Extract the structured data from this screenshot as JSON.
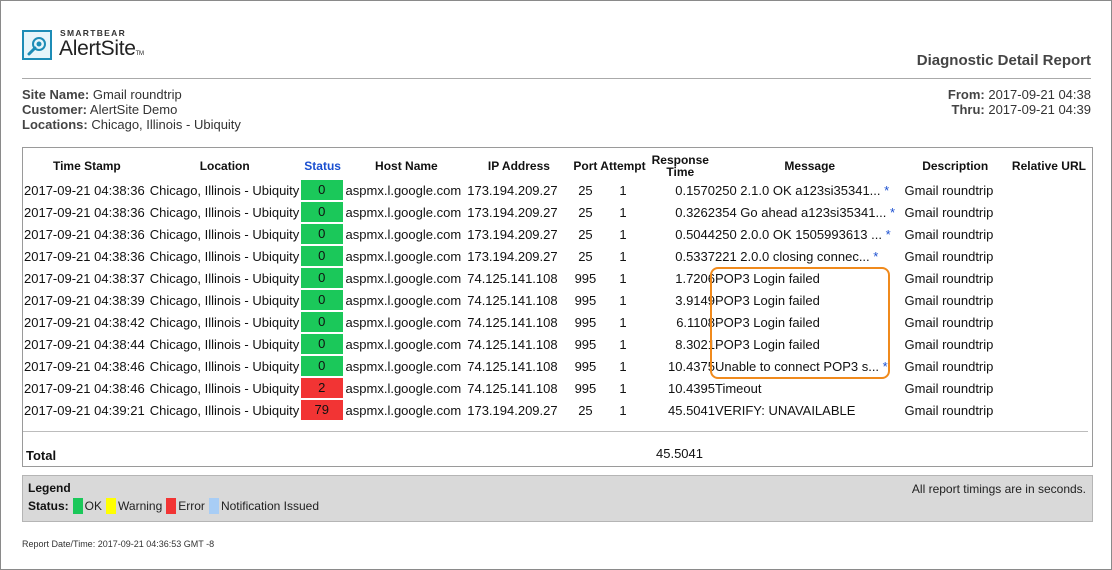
{
  "header": {
    "brand": "SMARTBEAR",
    "product": "AlertSite",
    "trademark": "TM",
    "report_title": "Diagnostic Detail Report"
  },
  "meta": {
    "site_name_label": "Site Name:",
    "site_name": "Gmail roundtrip",
    "customer_label": "Customer:",
    "customer": "AlertSite Demo",
    "locations_label": "Locations:",
    "locations": "Chicago, Illinois - Ubiquity",
    "from_label": "From:",
    "from": "2017-09-21 04:38",
    "thru_label": "Thru:",
    "thru": "2017-09-21 04:39"
  },
  "table": {
    "columns": [
      "Time Stamp",
      "Location",
      "Status",
      "Host Name",
      "IP Address",
      "Port",
      "Attempt",
      "Response Time",
      "Message",
      "Description",
      "Relative URL"
    ],
    "response_time_line1": "Response",
    "response_time_line2": "Time",
    "rows": [
      {
        "time": "2017-09-21 04:38:36",
        "location": "Chicago, Illinois - Ubiquity",
        "status": "0",
        "host": "aspmx.l.google.com",
        "ip": "173.194.209.27",
        "port": "25",
        "attempt": "1",
        "resp": "0.1570",
        "message": "250 2.1.0 OK a123si35341...",
        "star": "*",
        "desc": "Gmail roundtrip"
      },
      {
        "time": "2017-09-21 04:38:36",
        "location": "Chicago, Illinois - Ubiquity",
        "status": "0",
        "host": "aspmx.l.google.com",
        "ip": "173.194.209.27",
        "port": "25",
        "attempt": "1",
        "resp": "0.3262",
        "message": "354 Go ahead a123si35341...",
        "star": "*",
        "desc": "Gmail roundtrip"
      },
      {
        "time": "2017-09-21 04:38:36",
        "location": "Chicago, Illinois - Ubiquity",
        "status": "0",
        "host": "aspmx.l.google.com",
        "ip": "173.194.209.27",
        "port": "25",
        "attempt": "1",
        "resp": "0.5044",
        "message": "250 2.0.0 OK 1505993613 ...",
        "star": "*",
        "desc": "Gmail roundtrip"
      },
      {
        "time": "2017-09-21 04:38:36",
        "location": "Chicago, Illinois - Ubiquity",
        "status": "0",
        "host": "aspmx.l.google.com",
        "ip": "173.194.209.27",
        "port": "25",
        "attempt": "1",
        "resp": "0.5337",
        "message": "221 2.0.0 closing connec...",
        "star": "*",
        "desc": "Gmail roundtrip"
      },
      {
        "time": "2017-09-21 04:38:37",
        "location": "Chicago, Illinois - Ubiquity",
        "status": "0",
        "host": "aspmx.l.google.com",
        "ip": "74.125.141.108",
        "port": "995",
        "attempt": "1",
        "resp": "1.7206",
        "message": "POP3 Login failed",
        "star": "",
        "desc": "Gmail roundtrip"
      },
      {
        "time": "2017-09-21 04:38:39",
        "location": "Chicago, Illinois - Ubiquity",
        "status": "0",
        "host": "aspmx.l.google.com",
        "ip": "74.125.141.108",
        "port": "995",
        "attempt": "1",
        "resp": "3.9149",
        "message": "POP3 Login failed",
        "star": "",
        "desc": "Gmail roundtrip"
      },
      {
        "time": "2017-09-21 04:38:42",
        "location": "Chicago, Illinois - Ubiquity",
        "status": "0",
        "host": "aspmx.l.google.com",
        "ip": "74.125.141.108",
        "port": "995",
        "attempt": "1",
        "resp": "6.1108",
        "message": "POP3 Login failed",
        "star": "",
        "desc": "Gmail roundtrip"
      },
      {
        "time": "2017-09-21 04:38:44",
        "location": "Chicago, Illinois - Ubiquity",
        "status": "0",
        "host": "aspmx.l.google.com",
        "ip": "74.125.141.108",
        "port": "995",
        "attempt": "1",
        "resp": "8.3021",
        "message": "POP3 Login failed",
        "star": "",
        "desc": "Gmail roundtrip"
      },
      {
        "time": "2017-09-21 04:38:46",
        "location": "Chicago, Illinois - Ubiquity",
        "status": "0",
        "host": "aspmx.l.google.com",
        "ip": "74.125.141.108",
        "port": "995",
        "attempt": "1",
        "resp": "10.4375",
        "message": "Unable to connect POP3 s...",
        "star": "*",
        "desc": "Gmail roundtrip"
      },
      {
        "time": "2017-09-21 04:38:46",
        "location": "Chicago, Illinois - Ubiquity",
        "status": "2",
        "host": "aspmx.l.google.com",
        "ip": "74.125.141.108",
        "port": "995",
        "attempt": "1",
        "resp": "10.4395",
        "message": "Timeout",
        "star": "",
        "desc": "Gmail roundtrip"
      },
      {
        "time": "2017-09-21 04:39:21",
        "location": "Chicago, Illinois - Ubiquity",
        "status": "79",
        "host": "aspmx.l.google.com",
        "ip": "173.194.209.27",
        "port": "25",
        "attempt": "1",
        "resp": "45.5041",
        "message": "VERIFY: UNAVAILABLE",
        "star": "",
        "desc": "Gmail roundtrip"
      }
    ],
    "total_label": "Total",
    "total_value": "45.5041"
  },
  "legend": {
    "title": "Legend",
    "status_label": "Status:",
    "items": [
      {
        "label": "OK",
        "color": "#1bc85a"
      },
      {
        "label": "Warning",
        "color": "#ffff00"
      },
      {
        "label": "Error",
        "color": "#f23434"
      },
      {
        "label": "Notification Issued",
        "color": "#a8cdf5"
      }
    ],
    "note": "All report timings are in seconds."
  },
  "footer": {
    "report_datetime": "Report Date/Time: 2017-09-21 04:36:53 GMT -8"
  },
  "colors": {
    "ok": "#1bc85a",
    "error": "#f23434",
    "highlight": "#f08a1c",
    "link": "#1a4fd0"
  }
}
